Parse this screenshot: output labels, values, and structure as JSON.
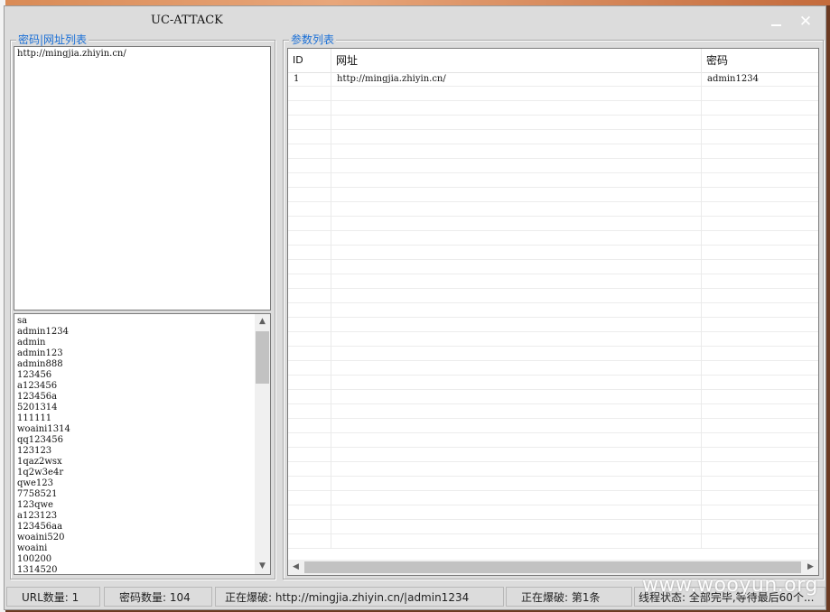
{
  "window": {
    "title": "UC-ATTACK"
  },
  "left_group": {
    "legend": "密码|网址列表"
  },
  "url_box": {
    "lines": [
      "http://mingjia.zhiyin.cn/"
    ]
  },
  "password_list": [
    "sa",
    "admin1234",
    "admin",
    "admin123",
    "admin888",
    "123456",
    "a123456",
    "123456a",
    "5201314",
    "111111",
    "woaini1314",
    "qq123456",
    "123123",
    "1qaz2wsx",
    "1q2w3e4r",
    "qwe123",
    "7758521",
    "123qwe",
    "a123123",
    "123456aa",
    "woaini520",
    "woaini",
    "100200",
    "1314520"
  ],
  "right_group": {
    "legend": "参数列表"
  },
  "table": {
    "columns": [
      "ID",
      "网址",
      "密码"
    ],
    "rows": [
      [
        "1",
        "http://mingjia.zhiyin.cn/",
        "admin1234"
      ]
    ]
  },
  "status": {
    "url_count": "URL数量: 1",
    "pwd_count": "密码数量: 104",
    "cracking": "正在爆破: http://mingjia.zhiyin.cn/|admin1234",
    "progress": "正在爆破: 第1条",
    "thread_state": "线程状态: 全部完毕,等待最后60个..."
  },
  "watermark": "www.wooyun.org"
}
